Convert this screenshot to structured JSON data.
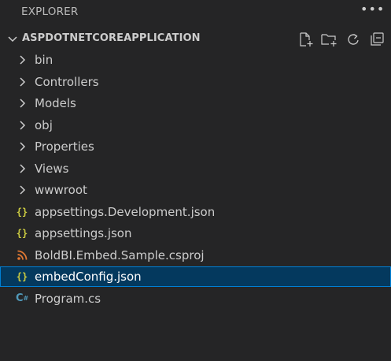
{
  "header": {
    "title": "EXPLORER",
    "more_icon": "ellipsis-icon"
  },
  "section": {
    "title": "ASPDOTNETCOREAPPLICATION",
    "expanded": true,
    "actions": [
      "new-file-icon",
      "new-folder-icon",
      "refresh-icon",
      "collapse-all-icon"
    ]
  },
  "tree": {
    "items": [
      {
        "label": "bin",
        "kind": "folder",
        "icon": "chevron-right-icon"
      },
      {
        "label": "Controllers",
        "kind": "folder",
        "icon": "chevron-right-icon"
      },
      {
        "label": "Models",
        "kind": "folder",
        "icon": "chevron-right-icon"
      },
      {
        "label": "obj",
        "kind": "folder",
        "icon": "chevron-right-icon"
      },
      {
        "label": "Properties",
        "kind": "folder",
        "icon": "chevron-right-icon"
      },
      {
        "label": "Views",
        "kind": "folder",
        "icon": "chevron-right-icon"
      },
      {
        "label": "wwwroot",
        "kind": "folder",
        "icon": "chevron-right-icon"
      },
      {
        "label": "appsettings.Development.json",
        "kind": "json",
        "icon": "json-file-icon"
      },
      {
        "label": "appsettings.json",
        "kind": "json",
        "icon": "json-file-icon"
      },
      {
        "label": "BoldBI.Embed.Sample.csproj",
        "kind": "csproj",
        "icon": "rss-file-icon"
      },
      {
        "label": "embedConfig.json",
        "kind": "json",
        "icon": "json-file-icon",
        "selected": true
      },
      {
        "label": "Program.cs",
        "kind": "cs",
        "icon": "csharp-file-icon"
      }
    ]
  },
  "colors": {
    "background": "#252526",
    "selected_bg": "#04395e",
    "selected_border": "#007fd4",
    "json_icon": "#cbcb41",
    "csproj_icon": "#e37933",
    "cs_icon": "#519aba"
  }
}
